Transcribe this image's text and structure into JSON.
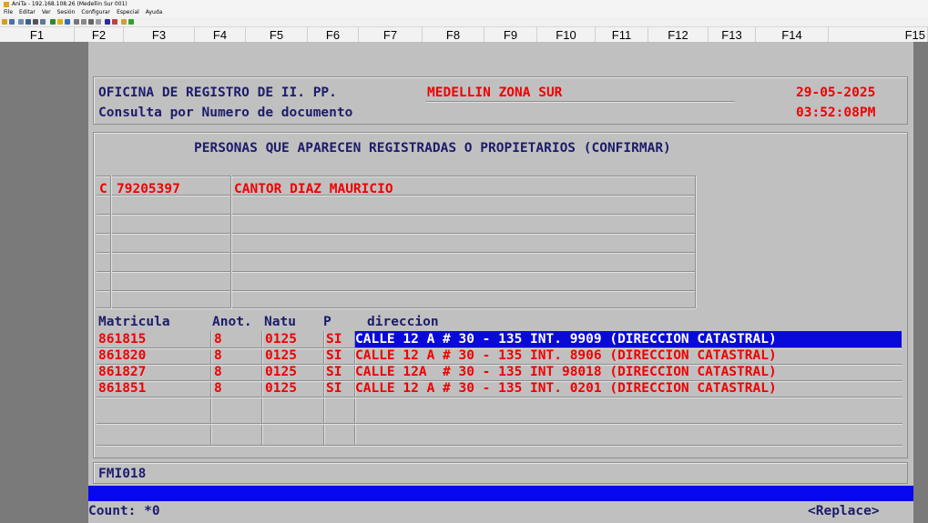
{
  "window": {
    "title": "AniTa - 192.168.108.26 (Medellin Sur 001)"
  },
  "menu": [
    "File",
    "Editar",
    "Ver",
    "Sesión",
    "Configurar",
    "Especial",
    "Ayuda"
  ],
  "fkeys": [
    "F1",
    "F2",
    "F3",
    "F4",
    "F5",
    "F6",
    "F7",
    "F8",
    "F9",
    "F10",
    "F11",
    "F12",
    "F13",
    "F14",
    "F15"
  ],
  "header": {
    "office_label": "OFICINA DE REGISTRO DE II. PP.",
    "office_name": "MEDELLIN ZONA SUR",
    "date": "29-05-2025",
    "subtitle": "Consulta por Numero de documento",
    "time": "03:52:08PM"
  },
  "persons": {
    "title": "PERSONAS QUE APARECEN REGISTRADAS O PROPIETARIOS (CONFIRMAR)",
    "rows": [
      {
        "type": "C",
        "doc": "79205397",
        "name": "CANTOR DIAZ MAURICIO"
      }
    ]
  },
  "properties": {
    "headers": {
      "matricula": "Matricula",
      "anot": "Anot.",
      "natu": "Natu",
      "p": "P",
      "direccion": "direccion"
    },
    "rows": [
      {
        "matricula": "861815",
        "anot": "8",
        "natu": "0125",
        "p": "SI",
        "direccion": "CALLE 12 A # 30 - 135 INT. 9909 (DIRECCION CATASTRAL)",
        "selected": true
      },
      {
        "matricula": "861820",
        "anot": "8",
        "natu": "0125",
        "p": "SI",
        "direccion": "CALLE 12 A # 30 - 135 INT. 8906 (DIRECCION CATASTRAL)",
        "selected": false
      },
      {
        "matricula": "861827",
        "anot": "8",
        "natu": "0125",
        "p": "SI",
        "direccion": "CALLE 12A  # 30 - 135 INT 98018 (DIRECCION CATASTRAL)",
        "selected": false
      },
      {
        "matricula": "861851",
        "anot": "8",
        "natu": "0125",
        "p": "SI",
        "direccion": "CALLE 12 A # 30 - 135 INT. 0201 (DIRECCION CATASTRAL)",
        "selected": false
      }
    ]
  },
  "form_code": "FMI018",
  "footer": {
    "count": "Count: *0",
    "mode": "<Replace>"
  },
  "colors": {
    "terminal_bg": "#c0c0c0",
    "label": "#1c1c6c",
    "value": "#f00000",
    "selection": "#0a0ad8",
    "status_bar": "#0808f0"
  }
}
